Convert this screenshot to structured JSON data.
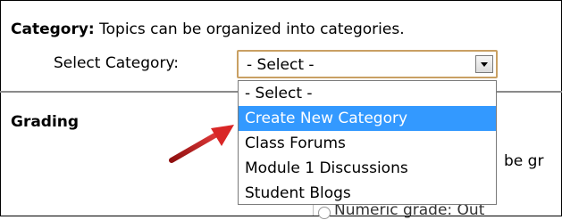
{
  "category": {
    "label": "Category:",
    "description": "Topics can be organized into categories."
  },
  "select": {
    "label": "Select Category:",
    "value": "- Select -",
    "options": [
      {
        "label": "- Select -",
        "highlighted": false
      },
      {
        "label": "Create New Category",
        "highlighted": true
      },
      {
        "label": "Class Forums",
        "highlighted": false
      },
      {
        "label": "Module 1 Discussions",
        "highlighted": false
      },
      {
        "label": "Student Blogs",
        "highlighted": false
      }
    ]
  },
  "grading": {
    "heading": "Grading",
    "partial_text_1": "be gr",
    "partial_text_2": "Numeric grade: Out"
  },
  "colors": {
    "highlight": "#3399ff",
    "select_border": "#c9a063",
    "annotation_arrow": "#cc1f1f"
  },
  "icons": {
    "dropdown": "chevron-down-icon",
    "annotation": "red-arrow-icon"
  }
}
